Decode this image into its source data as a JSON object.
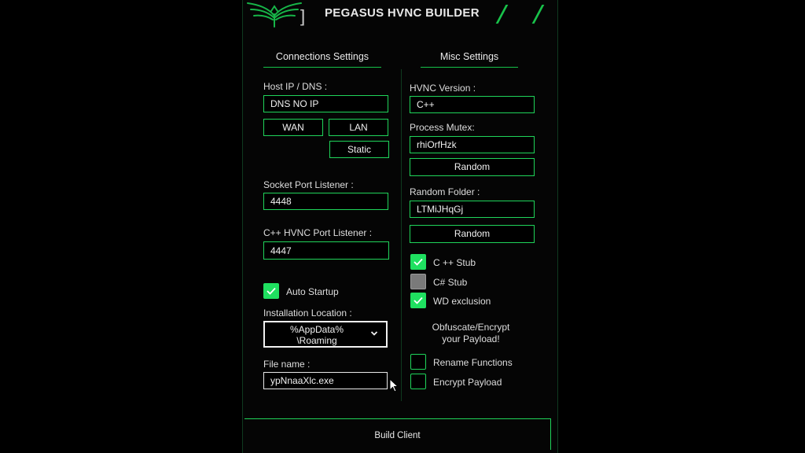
{
  "app": {
    "title": "PEGASUS HVNC BUILDER",
    "bracket": "]"
  },
  "sections": {
    "connections": "Connections Settings",
    "misc": "Misc Settings"
  },
  "connection": {
    "host_label": "Host IP / DNS :",
    "host_value": "DNS NO IP",
    "wan_label": "WAN",
    "lan_label": "LAN",
    "static_label": "Static",
    "socket_label": "Socket Port Listener :",
    "socket_value": "4448",
    "cpp_port_label": "C++ HVNC Port Listener :",
    "cpp_port_value": "4447",
    "auto_startup_label": "Auto Startup",
    "auto_startup_checked": true,
    "install_label": "Installation Location :",
    "install_value": "%AppData%\n\\Roaming",
    "filename_label": "File name :",
    "filename_value": "ypNnaaXlc.exe"
  },
  "misc": {
    "hvnc_version_label": "HVNC  Version :",
    "hvnc_version_value": "C++",
    "mutex_label": "Process Mutex:",
    "mutex_value": "rhiOrfHzk",
    "random_label": "Random",
    "folder_label": "Random Folder :",
    "folder_value": "LTMiJHqGj",
    "cpp_stub_label": "C ++ Stub",
    "cs_stub_label": "C#  Stub",
    "wd_label": "WD exclusion",
    "obfuscate_text": "Obfuscate/Encrypt\nyour Payload!",
    "rename_label": "Rename Functions",
    "encrypt_label": "Encrypt Payload"
  },
  "build_label": "Build Client",
  "colors": {
    "accent": "#1fd45a",
    "check_on": "#1fe060",
    "check_off": "#7a7a7a",
    "background": "#050505"
  },
  "icons": {
    "logo": "pegasus-wings-logo",
    "check": "check-icon",
    "dropdown": "chevron-down-icon",
    "cursor": "mouse-cursor-icon"
  }
}
